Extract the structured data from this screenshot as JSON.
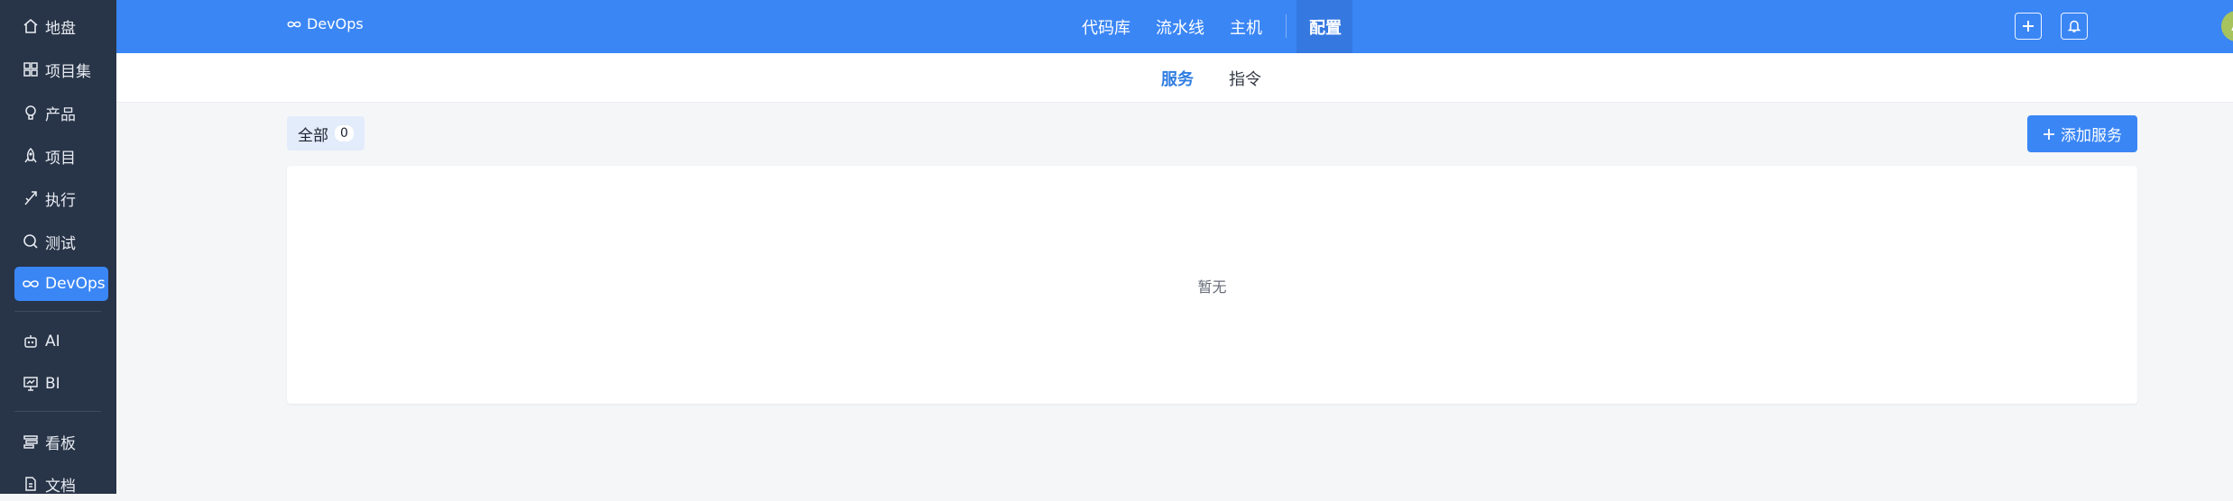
{
  "sidebar": {
    "items": [
      {
        "label": "地盘",
        "icon": "home-icon"
      },
      {
        "label": "项目集",
        "icon": "grid-icon"
      },
      {
        "label": "产品",
        "icon": "lightbulb-icon"
      },
      {
        "label": "项目",
        "icon": "rocket-icon"
      },
      {
        "label": "执行",
        "icon": "run-icon"
      },
      {
        "label": "测试",
        "icon": "search-icon"
      },
      {
        "label": "DevOps",
        "icon": "infinity-icon",
        "active": true
      },
      {
        "label": "AI",
        "icon": "robot-icon"
      },
      {
        "label": "BI",
        "icon": "chart-board-icon"
      },
      {
        "label": "看板",
        "icon": "kanban-icon"
      },
      {
        "label": "文档",
        "icon": "document-icon"
      }
    ]
  },
  "header": {
    "brand": "DevOps",
    "menu": [
      "代码库",
      "流水线",
      "主机",
      "配置"
    ],
    "active_menu": "配置",
    "avatar_letter": "A"
  },
  "subnav": {
    "tabs": [
      "服务",
      "指令"
    ],
    "active_tab": "服务"
  },
  "toolbar": {
    "filter_label": "全部",
    "filter_count": "0",
    "add_label": "添加服务"
  },
  "content": {
    "empty_text": "暂无"
  },
  "colors": {
    "sidebar_bg": "#283447",
    "primary": "#3a86f5",
    "avatar_bg": "#a6c35e"
  }
}
